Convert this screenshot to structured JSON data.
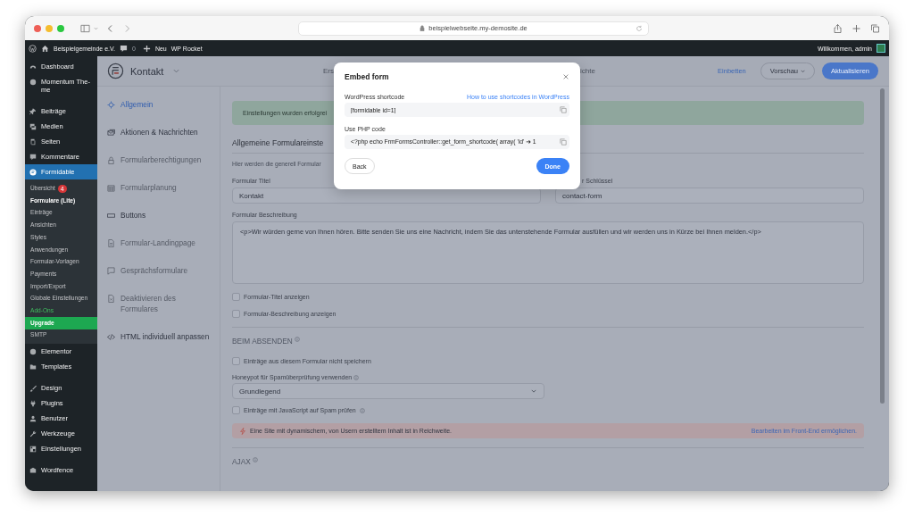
{
  "browser": {
    "url": "beispielwebseite.my-demosite.de"
  },
  "admin_bar": {
    "site": "Beispielgemeinde e.V.",
    "comments": "0",
    "new": "Neu",
    "plugin": "WP Rocket",
    "greeting": "Willkommen, admin"
  },
  "admin_menu": [
    [
      {
        "label": "Dashboard",
        "selected": false
      },
      {
        "label": "Momentum The-me",
        "selected": false
      }
    ],
    [
      {
        "label": "Beiträge",
        "selected": false
      },
      {
        "label": "Medien",
        "selected": false
      },
      {
        "label": "Seiten",
        "selected": false
      },
      {
        "label": "Kommentare",
        "selected": false
      },
      {
        "label": "Formidable",
        "selected": true,
        "children": [
          {
            "label": "Übersicht",
            "kind": "normal",
            "badge": "4"
          },
          {
            "label": "Formulare (Lite)",
            "kind": "current"
          },
          {
            "label": "Einträge",
            "kind": "normal"
          },
          {
            "label": "Ansichten",
            "kind": "normal"
          },
          {
            "label": "Styles",
            "kind": "normal"
          },
          {
            "label": "Anwendungen",
            "kind": "normal"
          },
          {
            "label": "Formular-Vorlagen",
            "kind": "normal"
          },
          {
            "label": "Payments",
            "kind": "normal"
          },
          {
            "label": "Import/Export",
            "kind": "normal"
          },
          {
            "label": "Globale Einstellungen",
            "kind": "normal"
          },
          {
            "label": "Add-Ons",
            "kind": "addon"
          },
          {
            "label": "Upgrade",
            "kind": "upgrade"
          },
          {
            "label": "SMTP",
            "kind": "normal"
          }
        ]
      }
    ],
    [
      {
        "label": "Elementor",
        "selected": false
      },
      {
        "label": "Templates",
        "selected": false
      }
    ],
    [
      {
        "label": "Design",
        "selected": false
      },
      {
        "label": "Plugins",
        "selected": false
      },
      {
        "label": "Benutzer",
        "selected": false
      },
      {
        "label": "Werkzeuge",
        "selected": false
      },
      {
        "label": "Einstellungen",
        "selected": false
      }
    ],
    [
      {
        "label": "Wordfence",
        "selected": false
      }
    ]
  ],
  "header": {
    "form_title": "Kontakt",
    "tabs": [
      {
        "label": "Ers"
      },
      {
        "label": "ichte"
      }
    ],
    "embed": "Einbetten",
    "preview": "Vorschau",
    "update": "Aktualisieren"
  },
  "settings_nav": [
    {
      "label": "Allgemein",
      "selected": true,
      "disabled": false
    },
    {
      "label": "Aktionen & Nachrichten",
      "selected": false,
      "disabled": false
    },
    {
      "label": "Formularberechtigungen",
      "selected": false,
      "disabled": true
    },
    {
      "label": "Formularplanung",
      "selected": false,
      "disabled": true
    },
    {
      "label": "Buttons",
      "selected": false,
      "disabled": false
    },
    {
      "label": "Formular-Landingpage",
      "selected": false,
      "disabled": true
    },
    {
      "label": "Gesprächsformulare",
      "selected": false,
      "disabled": true
    },
    {
      "label": "Deaktivieren des Formulares",
      "selected": false,
      "disabled": true
    },
    {
      "label": "HTML individuell anpassen",
      "selected": false,
      "disabled": false
    }
  ],
  "notice": "Einstellungen wurden erfolgrei",
  "section_title": "Allgemeine Formulareinste",
  "section_description": "Hier werden die generell Formular",
  "title_field": {
    "label": "Formular Titel",
    "value": "Kontakt"
  },
  "key_field": {
    "label": "r Schlüssel",
    "value": "contact-form"
  },
  "description_field": {
    "label": "Formular Beschreibung",
    "value": "<p>Wir würden gerne von Ihnen hören. Bitte senden Sie uns eine Nachricht, indem Sie das untenstehende Formular ausfüllen und wir werden uns in Kürze bei Ihnen melden.</p>"
  },
  "display_options": [
    {
      "label": "Formular-Titel anzeigen",
      "checked": false
    },
    {
      "label": "Formular-Beschreibung anzeigen",
      "checked": false
    }
  ],
  "on_submit": {
    "heading": "BEIM ABSENDEN",
    "options": [
      {
        "label": "Einträge aus diesem Formular nicht speichern",
        "checked": false
      }
    ],
    "honeypot": {
      "label": "Honeypot für Spamüberprüfung verwenden",
      "value": "Grundlegend"
    },
    "js_check": {
      "label": "Einträge mit JavaScript auf Spam prüfen",
      "checked": false
    },
    "alert": {
      "text": "Eine Site mit dynamischem, von Usern erstelltem Inhalt ist in Reichweite.",
      "link": "Bearbeiten im Front-End ermöglichen."
    }
  },
  "ajax": {
    "heading": "AJAX"
  },
  "modal": {
    "title": "Embed form",
    "shortcode": {
      "label": "WordPress shortcode",
      "help_link": "How to use shortcodes in WordPress",
      "value": "[formidable id=1]"
    },
    "php": {
      "label": "Use PHP code",
      "value": "<?php echo FrmFormsController::get_form_shortcode( array( 'id' ➔ 1"
    },
    "back": "Back",
    "done": "Done"
  }
}
